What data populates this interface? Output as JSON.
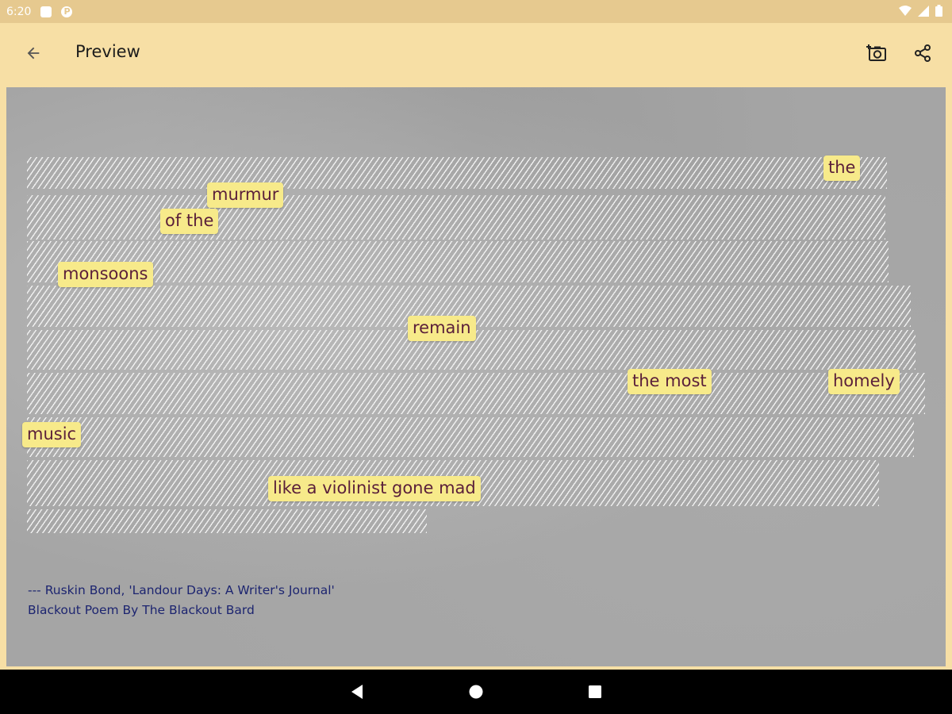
{
  "status_bar": {
    "time": "6:20",
    "notification_icons": [
      "notification-icon",
      "app-icon"
    ],
    "status_icons": [
      "wifi-icon",
      "signal-icon",
      "battery-icon"
    ]
  },
  "toolbar": {
    "back_icon": "arrow-back-icon",
    "title": "Preview",
    "screenshot_icon": "camera-add-icon",
    "share_icon": "share-icon"
  },
  "poem": {
    "words": [
      "the",
      "murmur",
      "of the",
      "monsoons",
      "remain",
      "the most",
      "homely",
      "music",
      "like a violinist gone mad"
    ],
    "attribution_line1": "--- Ruskin Bond, 'Landour Days: A Writer's Journal'",
    "attribution_line2": "Blackout Poem By The Blackout Bard"
  },
  "colors": {
    "header": "#f7dfa5",
    "status_bar": "#e6c98f",
    "word_highlight": "#f7ea8a",
    "word_text": "#5a1f3a",
    "attribution_text": "#1d2570"
  },
  "nav_bar": {
    "back": "nav-back-icon",
    "home": "nav-home-icon",
    "recents": "nav-recents-icon"
  }
}
